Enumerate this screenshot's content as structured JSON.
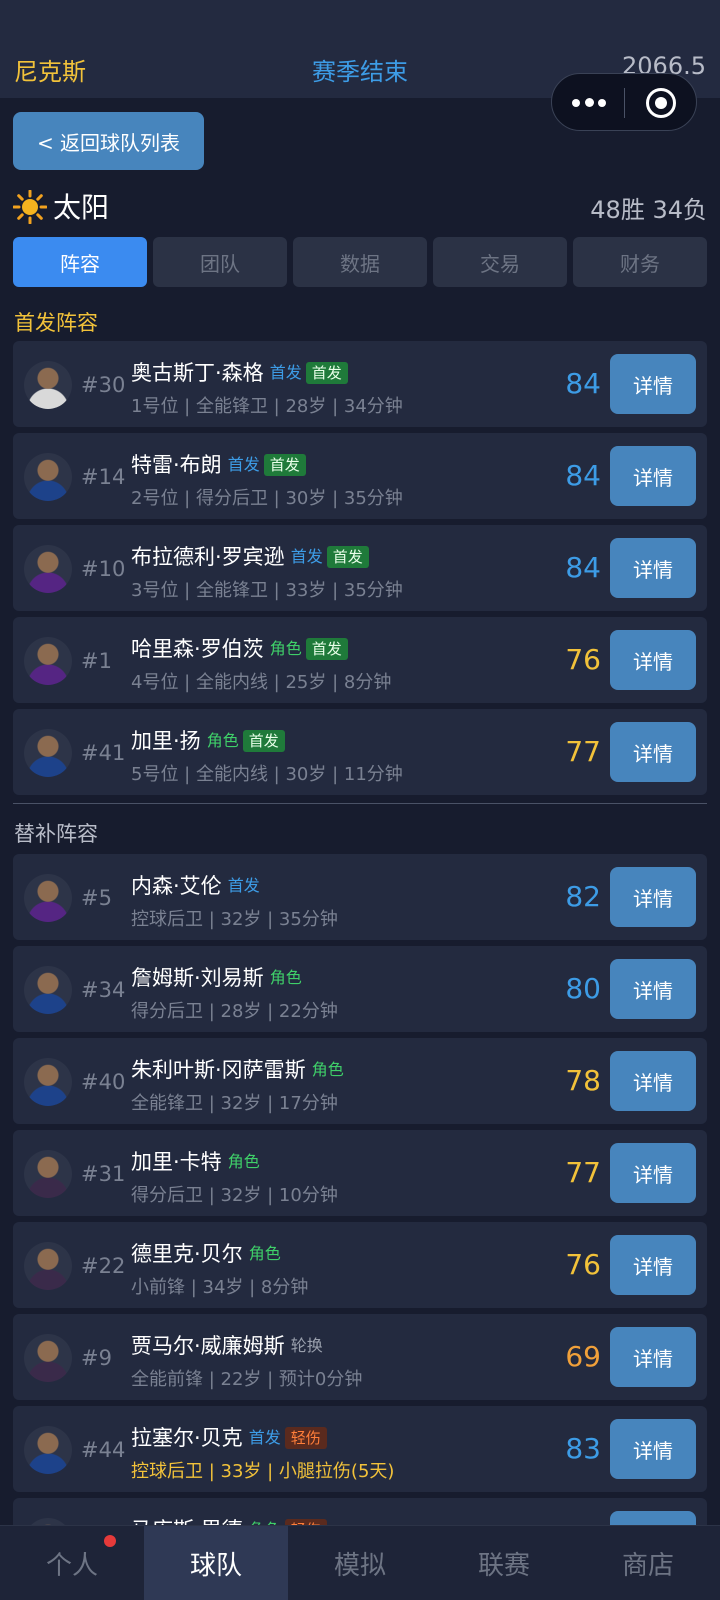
{
  "top": {
    "team": "尼克斯",
    "status": "赛季结束",
    "money": "2066.5"
  },
  "capsule": {
    "menu_icon": "more-dots-icon",
    "close_icon": "target-icon"
  },
  "back_button": "< 返回球队列表",
  "team": {
    "name": "太阳",
    "icon": "sun-icon",
    "record": "48胜 34负"
  },
  "tabs": [
    {
      "label": "阵容",
      "active": true
    },
    {
      "label": "团队"
    },
    {
      "label": "数据"
    },
    {
      "label": "交易"
    },
    {
      "label": "财务"
    }
  ],
  "starters_title": "首发阵容",
  "bench_title": "替补阵容",
  "detail_label": "详情",
  "starters": [
    {
      "num": "#30",
      "name": "奥古斯丁·森格",
      "role": "首发",
      "badge": "首发",
      "meta": "1号位 | 全能锋卫 | 28岁 | 34分钟",
      "rating": "84",
      "rating_color": "#3d9ce6",
      "jersey": "#d9d9d9"
    },
    {
      "num": "#14",
      "name": "特雷·布朗",
      "role": "首发",
      "badge": "首发",
      "meta": "2号位 | 得分后卫 | 30岁 | 35分钟",
      "rating": "84",
      "rating_color": "#3d9ce6",
      "jersey": "#1d428a"
    },
    {
      "num": "#10",
      "name": "布拉德利·罗宾逊",
      "role": "首发",
      "badge": "首发",
      "meta": "3号位 | 全能锋卫 | 33岁 | 35分钟",
      "rating": "84",
      "rating_color": "#3d9ce6",
      "jersey": "#552583"
    },
    {
      "num": "#1",
      "name": "哈里森·罗伯茨",
      "role": "角色",
      "badge": "首发",
      "meta": "4号位 | 全能内线 | 25岁 | 8分钟",
      "rating": "76",
      "rating_color": "#f2c23a",
      "jersey": "#552583"
    },
    {
      "num": "#41",
      "name": "加里·扬",
      "role": "角色",
      "badge": "首发",
      "meta": "5号位 | 全能内线 | 30岁 | 11分钟",
      "rating": "77",
      "rating_color": "#f2c23a",
      "jersey": "#1d428a"
    }
  ],
  "bench": [
    {
      "num": "#5",
      "name": "内森·艾伦",
      "role": "首发",
      "meta": "控球后卫 | 32岁 | 35分钟",
      "rating": "82",
      "rating_color": "#3d9ce6",
      "jersey": "#552583"
    },
    {
      "num": "#34",
      "name": "詹姆斯·刘易斯",
      "role": "角色",
      "meta": "得分后卫 | 28岁 | 22分钟",
      "rating": "80",
      "rating_color": "#3d9ce6",
      "jersey": "#1d428a"
    },
    {
      "num": "#40",
      "name": "朱利叶斯·冈萨雷斯",
      "role": "角色",
      "meta": "全能锋卫 | 32岁 | 17分钟",
      "rating": "78",
      "rating_color": "#f2c23a",
      "jersey": "#1d428a"
    },
    {
      "num": "#31",
      "name": "加里·卡特",
      "role": "角色",
      "meta": "得分后卫 | 32岁 | 10分钟",
      "rating": "77",
      "rating_color": "#f2c23a",
      "jersey": "#3a2a4a"
    },
    {
      "num": "#22",
      "name": "德里克·贝尔",
      "role": "角色",
      "meta": "小前锋 | 34岁 | 8分钟",
      "rating": "76",
      "rating_color": "#f2c23a",
      "jersey": "#3a2a4a"
    },
    {
      "num": "#9",
      "name": "贾马尔·威廉姆斯",
      "role": "轮换",
      "meta": "全能前锋 | 22岁 | 预计0分钟",
      "rating": "69",
      "rating_color": "#f0a03a",
      "jersey": "#3a2a4a"
    },
    {
      "num": "#44",
      "name": "拉塞尔·贝克",
      "role": "首发",
      "injury": "轻伤",
      "meta": "控球后卫 | 33岁 | 小腿拉伤(5天)",
      "meta_injured": true,
      "rating": "83",
      "rating_color": "#3d9ce6",
      "jersey": "#1d428a"
    },
    {
      "num": "",
      "name": "马库斯·里德",
      "role": "角色",
      "injury": "轻伤",
      "meta": "",
      "rating": "",
      "rating_color": "#f2c23a",
      "jersey": "#1d428a"
    }
  ],
  "nav": [
    {
      "label": "个人",
      "dot": true
    },
    {
      "label": "球队",
      "active": true
    },
    {
      "label": "模拟"
    },
    {
      "label": "联赛"
    },
    {
      "label": "商店"
    }
  ]
}
